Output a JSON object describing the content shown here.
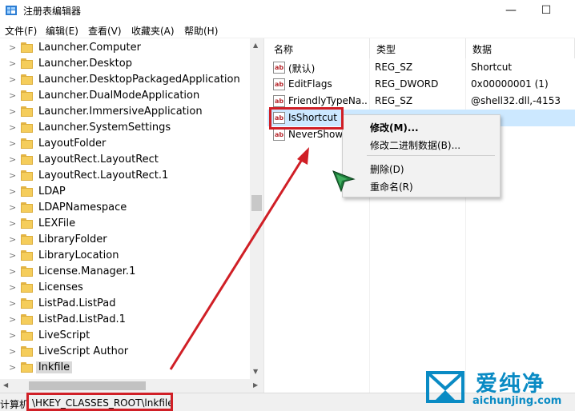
{
  "window": {
    "title": "注册表编辑器",
    "minimize_glyph": "—",
    "maximize_glyph": "☐"
  },
  "menu": [
    {
      "label": "文件(F)"
    },
    {
      "label": "编辑(E)"
    },
    {
      "label": "查看(V)"
    },
    {
      "label": "收藏夹(A)"
    },
    {
      "label": "帮助(H)"
    }
  ],
  "tree": {
    "items": [
      {
        "label": "Launcher.Computer"
      },
      {
        "label": "Launcher.Desktop"
      },
      {
        "label": "Launcher.DesktopPackagedApplication"
      },
      {
        "label": "Launcher.DualModeApplication"
      },
      {
        "label": "Launcher.ImmersiveApplication"
      },
      {
        "label": "Launcher.SystemSettings"
      },
      {
        "label": "LayoutFolder"
      },
      {
        "label": "LayoutRect.LayoutRect"
      },
      {
        "label": "LayoutRect.LayoutRect.1"
      },
      {
        "label": "LDAP"
      },
      {
        "label": "LDAPNamespace"
      },
      {
        "label": "LEXFile"
      },
      {
        "label": "LibraryFolder"
      },
      {
        "label": "LibraryLocation"
      },
      {
        "label": "License.Manager.1"
      },
      {
        "label": "Licenses"
      },
      {
        "label": "ListPad.ListPad"
      },
      {
        "label": "ListPad.ListPad.1"
      },
      {
        "label": "LiveScript"
      },
      {
        "label": "LiveScript Author"
      },
      {
        "label": "lnkfile",
        "selected": true
      }
    ]
  },
  "list": {
    "headers": {
      "name": "名称",
      "type": "类型",
      "data": "数据"
    },
    "rows": [
      {
        "name": "(默认)",
        "type": "REG_SZ",
        "data": "Shortcut"
      },
      {
        "name": "EditFlags",
        "type": "REG_DWORD",
        "data": "0x00000001 (1)"
      },
      {
        "name": "FriendlyTypeNa...",
        "type": "REG_SZ",
        "data": "@shell32.dll,-4153"
      },
      {
        "name": "IsShortcut",
        "type": "",
        "data": "",
        "selected": true
      },
      {
        "name": "NeverShowE",
        "type": "",
        "data": ""
      }
    ],
    "value_icon_text": "ab"
  },
  "context_menu": {
    "items": [
      {
        "label": "修改(M)...",
        "bold": true
      },
      {
        "label": "修改二进制数据(B)..."
      },
      {
        "label": "删除(D)"
      },
      {
        "label": "重命名(R)"
      }
    ]
  },
  "status": {
    "prefix": "计算机",
    "path": "\\HKEY_CLASSES_ROOT\\lnkfile"
  },
  "watermark": {
    "name": "爱纯净",
    "url": "aichunjing.com"
  },
  "colors": {
    "highlight_red": "#d01f26",
    "selection_blue": "#cce8ff",
    "folder_yellow": "#f5cd5b",
    "watermark_blue": "#0a8bc4"
  },
  "icons": [
    "regedit-app-icon",
    "folder-icon",
    "string-value-icon",
    "arrow-annotation",
    "mouse-cursor-icon"
  ]
}
